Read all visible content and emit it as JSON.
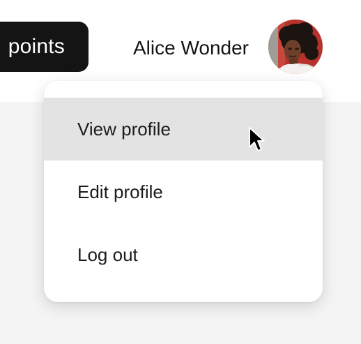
{
  "header": {
    "points_label": "points",
    "user_name": "Alice Wonder",
    "avatar_icon": "user-avatar-photo"
  },
  "profile_menu": {
    "items": [
      {
        "label": "View profile",
        "state": "hovered"
      },
      {
        "label": "Edit profile"
      },
      {
        "label": "Log out"
      }
    ]
  },
  "colors": {
    "points_button_bg": "#141414",
    "hover_bg": "#e3e3e3",
    "page_bg": "#f4f4f4",
    "avatar_bg": "#b5332c"
  }
}
